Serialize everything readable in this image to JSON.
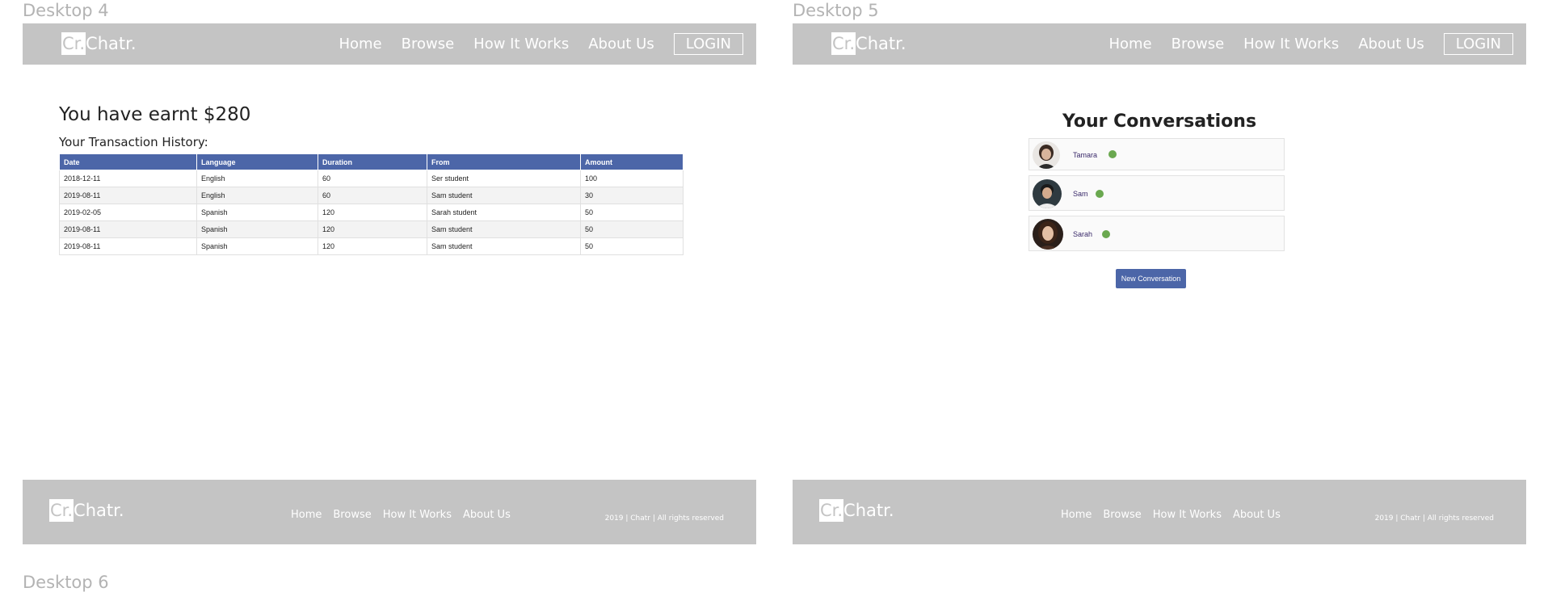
{
  "frames": {
    "desktop4_label": "Desktop 4",
    "desktop5_label": "Desktop 5",
    "desktop6_label": "Desktop 6"
  },
  "brand": {
    "box": "Cr.",
    "text": "Chatr."
  },
  "nav": {
    "links": [
      "Home",
      "Browse",
      "How It Works",
      "About Us"
    ],
    "login": "LOGIN"
  },
  "footer": {
    "links": [
      "Home",
      "Browse",
      "How It Works",
      "About Us"
    ],
    "copyright": "2019 | Chatr | All rights reserved"
  },
  "earnings": {
    "title": "You have earnt $280",
    "history_title": "Your Transaction History:",
    "columns": [
      "Date",
      "Language",
      "Duration",
      "From",
      "Amount"
    ],
    "rows": [
      [
        "2018-12-11",
        "English",
        "60",
        "Ser student",
        "100"
      ],
      [
        "2019-08-11",
        "English",
        "60",
        "Sam student",
        "30"
      ],
      [
        "2019-02-05",
        "Spanish",
        "120",
        "Sarah student",
        "50"
      ],
      [
        "2019-08-11",
        "Spanish",
        "120",
        "Sam student",
        "50"
      ],
      [
        "2019-08-11",
        "Spanish",
        "120",
        "Sam student",
        "50"
      ]
    ]
  },
  "conversations": {
    "title": "Your Conversations",
    "items": [
      {
        "name": "Tamara",
        "status": "online"
      },
      {
        "name": "Sam",
        "status": "online"
      },
      {
        "name": "Sarah",
        "status": "online"
      }
    ],
    "new_button": "New Conversation"
  },
  "colors": {
    "bar": "#c4c4c4",
    "accent": "#4c66a8",
    "online": "#6aa84f"
  }
}
